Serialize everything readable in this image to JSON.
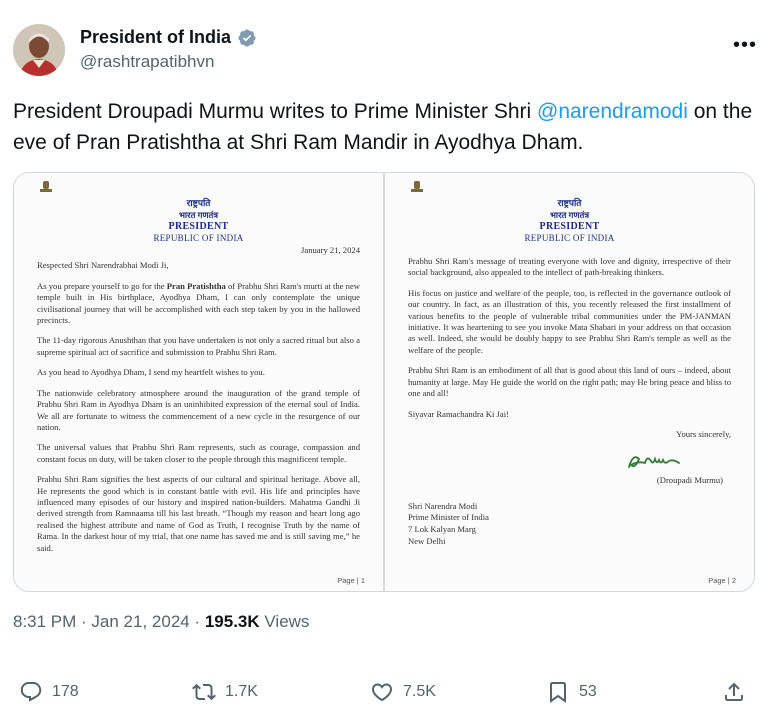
{
  "author": {
    "name": "President of India",
    "handle": "@rashtrapatibhvn"
  },
  "tweet": {
    "text_before": "President Droupadi Murmu writes to Prime Minister Shri ",
    "mention": "@narendramodi",
    "text_after": " on the eve of Pran Pratishtha at Shri Ram Mandir in Ayodhya Dham."
  },
  "letter": {
    "header": {
      "hindi_line1": "राष्ट्रपति",
      "hindi_line2": "भारत गणतंत्र",
      "en_line1": "PRESIDENT",
      "en_line2": "REPUBLIC OF INDIA"
    },
    "page1": {
      "date": "January 21, 2024",
      "salutation": "Respected Shri Narendrabhai Modi Ji,",
      "p1_before": "As you prepare yourself to go for the ",
      "p1_bold": "Pran Pratishtha",
      "p1_after": " of Prabhu Shri Ram's murti at the new temple built in His birthplace, Ayodhya Dham, I can only contemplate the unique civilisational journey that will be accomplished with each step taken by you in the hallowed precincts.",
      "p2": "The 11-day rigorous Anushthan that you have undertaken is not only a sacred ritual but also a supreme spiritual act of sacrifice and submission to Prabhu Shri Ram.",
      "p3": "As you head to Ayodhya Dham, I send my heartfelt wishes to you.",
      "p4": "The nationwide celebratory atmosphere around the inauguration of the grand temple of Prabhu Shri Ram in Ayodhya Dham is an uninhibited expression of the eternal soul of India. We all are fortunate to witness the commencement of a new cycle in the resurgence of our nation.",
      "p5": "The universal values that Prabhu Shri Ram represents, such as courage, compassion and constant focus on duty, will be taken closer to the people through this magnificent temple.",
      "p6": "Prabhu Shri Ram signifies the best aspects of our cultural and spiritual heritage. Above all, He represents the good which is in constant battle with evil. His life and principles have influenced many episodes of our history and inspired nation-builders. Mahatma Gandhi Ji derived strength from Ramnaama till his last breath. “Though my reason and heart long ago realised the highest attribute and name of God as Truth, I recognise Truth by the name of Rama. In the darkest hour of my trial, that one name has saved me and is still saving me,” he said.",
      "page_label": "Page | 1"
    },
    "page2": {
      "p1": "Prabhu Shri Ram's message of treating everyone with love and dignity, irrespective of their social background, also appealed to the intellect of path-breaking thinkers.",
      "p2": "His focus on justice and welfare of the people, too, is reflected in the governance outlook of our country. In fact, as an illustration of this, you recently released the first installment of various benefits to the people of vulnerable tribal communities under the PM-JANMAN initiative. It was heartening to see you invoke Mata Shabari in your address on that occasion as well. Indeed, she would be doubly happy to see Prabhu Shri Ram's temple as well as the welfare of the people.",
      "p3": "Prabhu Shri Ram is an embodiment of all that is good about this land of ours – indeed, about humanity at large. May He guide the world on the right path; may He bring peace and bliss to one and all!",
      "p4": "Siyavar Ramachandra Ki Jai!",
      "closing": "Yours sincerely,",
      "signatory": "(Droupadi Murmu)",
      "addr1": "Shri Narendra Modi",
      "addr2": "Prime Minister of India",
      "addr3": "7 Lok Kalyan Marg",
      "addr4": "New Delhi",
      "page_label": "Page | 2"
    }
  },
  "meta": {
    "time": "8:31 PM",
    "sep1": " · ",
    "date": "Jan 21, 2024",
    "sep2": " · ",
    "views": "195.3K",
    "views_label": " Views"
  },
  "actions": {
    "replies": "178",
    "reposts": "1.7K",
    "likes": "7.5K",
    "bookmarks": "53"
  },
  "colors": {
    "accent": "#1d9bf0",
    "text": "#0f1419",
    "muted": "#536471",
    "letterhead": "#1c2d8a",
    "signature": "#2e7d32"
  },
  "icons": [
    "verified-badge-icon",
    "more-icon",
    "reply-icon",
    "repost-icon",
    "like-icon",
    "bookmark-icon",
    "share-icon",
    "emblem-icon"
  ]
}
